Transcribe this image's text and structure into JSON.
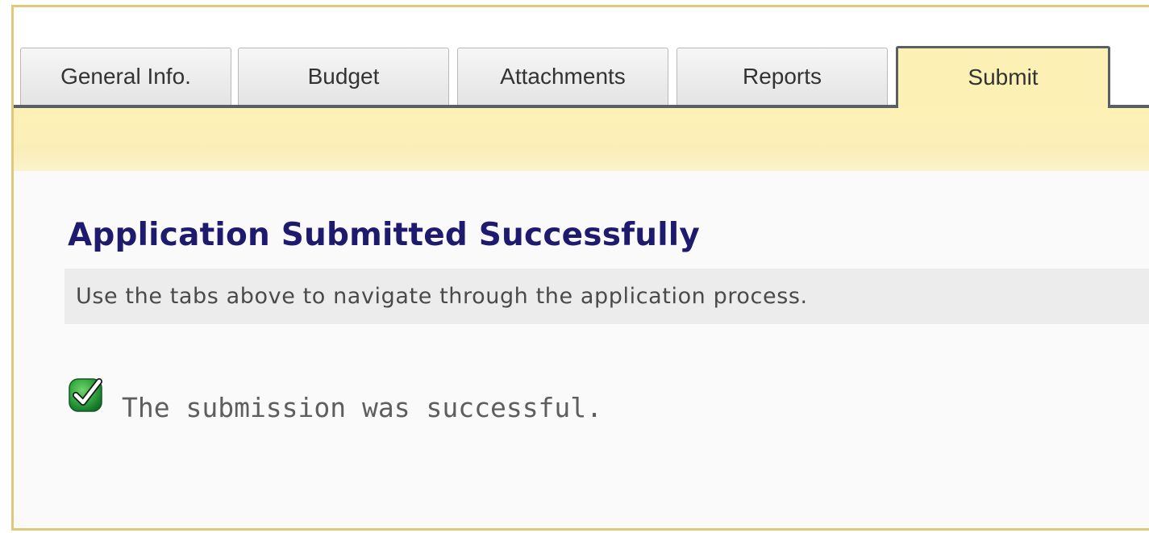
{
  "tabs": [
    {
      "label": "General Info.",
      "active": false
    },
    {
      "label": "Budget",
      "active": false
    },
    {
      "label": "Attachments",
      "active": false
    },
    {
      "label": "Reports",
      "active": false
    },
    {
      "label": "Submit",
      "active": true
    }
  ],
  "page": {
    "title": "Application Submitted Successfully",
    "instructions": "Use the tabs above to navigate through the application process.",
    "status_message": "The submission was successful.",
    "status_icon": "green-check-icon"
  },
  "colors": {
    "accent_band": "#fdf1b6",
    "title": "#1e1b6e",
    "success": "#1f9a3a"
  }
}
